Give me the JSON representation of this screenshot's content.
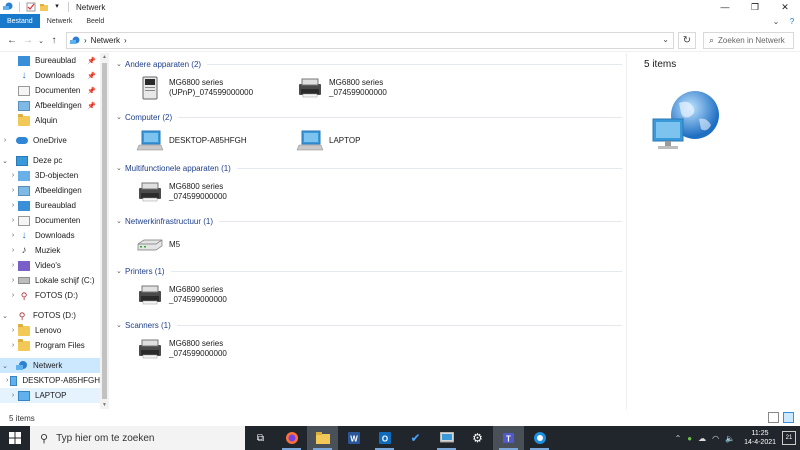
{
  "window": {
    "title": "Netwerk",
    "controls": {
      "minimize": "—",
      "maximize": "❐",
      "close": "✕"
    }
  },
  "ribbon": {
    "tabs": [
      {
        "label": "Bestand",
        "active": true
      },
      {
        "label": "Netwerk",
        "active": false
      },
      {
        "label": "Beeld",
        "active": false
      }
    ],
    "collapse": "⌄",
    "help": "?"
  },
  "address": {
    "path": "Netwerk",
    "search_placeholder": "Zoeken in Netwerk"
  },
  "sidebar": {
    "items": [
      {
        "label": "Bureaublad",
        "icon": "desktop-icon",
        "pinned": true
      },
      {
        "label": "Downloads",
        "icon": "download-icon",
        "pinned": true
      },
      {
        "label": "Documenten",
        "icon": "documents-icon",
        "pinned": true
      },
      {
        "label": "Afbeeldingen",
        "icon": "pictures-icon",
        "pinned": true
      },
      {
        "label": "Alquin",
        "icon": "folder-icon"
      },
      {
        "label": "OneDrive",
        "icon": "onedrive-icon"
      },
      {
        "label": "Deze pc",
        "icon": "pc-icon"
      },
      {
        "label": "3D-objecten",
        "icon": "3d-objects-icon"
      },
      {
        "label": "Afbeeldingen",
        "icon": "pictures-icon"
      },
      {
        "label": "Bureaublad",
        "icon": "desktop-icon"
      },
      {
        "label": "Documenten",
        "icon": "documents-icon"
      },
      {
        "label": "Downloads",
        "icon": "download-icon"
      },
      {
        "label": "Muziek",
        "icon": "music-icon"
      },
      {
        "label": "Video's",
        "icon": "videos-icon"
      },
      {
        "label": "Lokale schijf (C:)",
        "icon": "drive-icon"
      },
      {
        "label": "FOTOS (D:)",
        "icon": "usb-drive-icon"
      },
      {
        "label": "FOTOS (D:)",
        "icon": "usb-drive-icon"
      },
      {
        "label": "Lenovo",
        "icon": "folder-icon"
      },
      {
        "label": "Program Files",
        "icon": "folder-icon"
      },
      {
        "label": "Netwerk",
        "icon": "network-icon"
      },
      {
        "label": "DESKTOP-A85HFGH",
        "icon": "computer-icon"
      },
      {
        "label": "LAPTOP",
        "icon": "computer-icon"
      }
    ]
  },
  "groups": [
    {
      "title": "Andere apparaten (2)",
      "devices": [
        {
          "name": "MG6800 series\n(UPnP)_074599000000",
          "icon": "server-device-icon"
        },
        {
          "name": "MG6800 series\n_074599000000",
          "icon": "printer-icon"
        }
      ]
    },
    {
      "title": "Computer (2)",
      "devices": [
        {
          "name": "DESKTOP-A85HFGH",
          "icon": "computer-icon"
        },
        {
          "name": "LAPTOP",
          "icon": "computer-icon"
        }
      ]
    },
    {
      "title": "Multifunctionele apparaten (1)",
      "devices": [
        {
          "name": "MG6800 series\n_074599000000",
          "icon": "printer-icon"
        }
      ]
    },
    {
      "title": "Netwerkinfrastructuur (1)",
      "devices": [
        {
          "name": "M5",
          "icon": "router-icon"
        }
      ]
    },
    {
      "title": "Printers (1)",
      "devices": [
        {
          "name": "MG6800 series\n_074599000000",
          "icon": "printer-icon"
        }
      ]
    },
    {
      "title": "Scanners (1)",
      "devices": [
        {
          "name": "MG6800 series\n_074599000000",
          "icon": "printer-icon"
        }
      ]
    }
  ],
  "details": {
    "count": "5 items"
  },
  "status": {
    "text": "5 items"
  },
  "taskbar": {
    "search_placeholder": "Typ hier om te zoeken",
    "time": "11:25",
    "date": "14-4-2021",
    "notifications": "21"
  },
  "colors": {
    "accent": "#1979ca",
    "group_header": "#1e3f8a",
    "selection": "#cce8ff",
    "taskbar": "#20262c"
  }
}
